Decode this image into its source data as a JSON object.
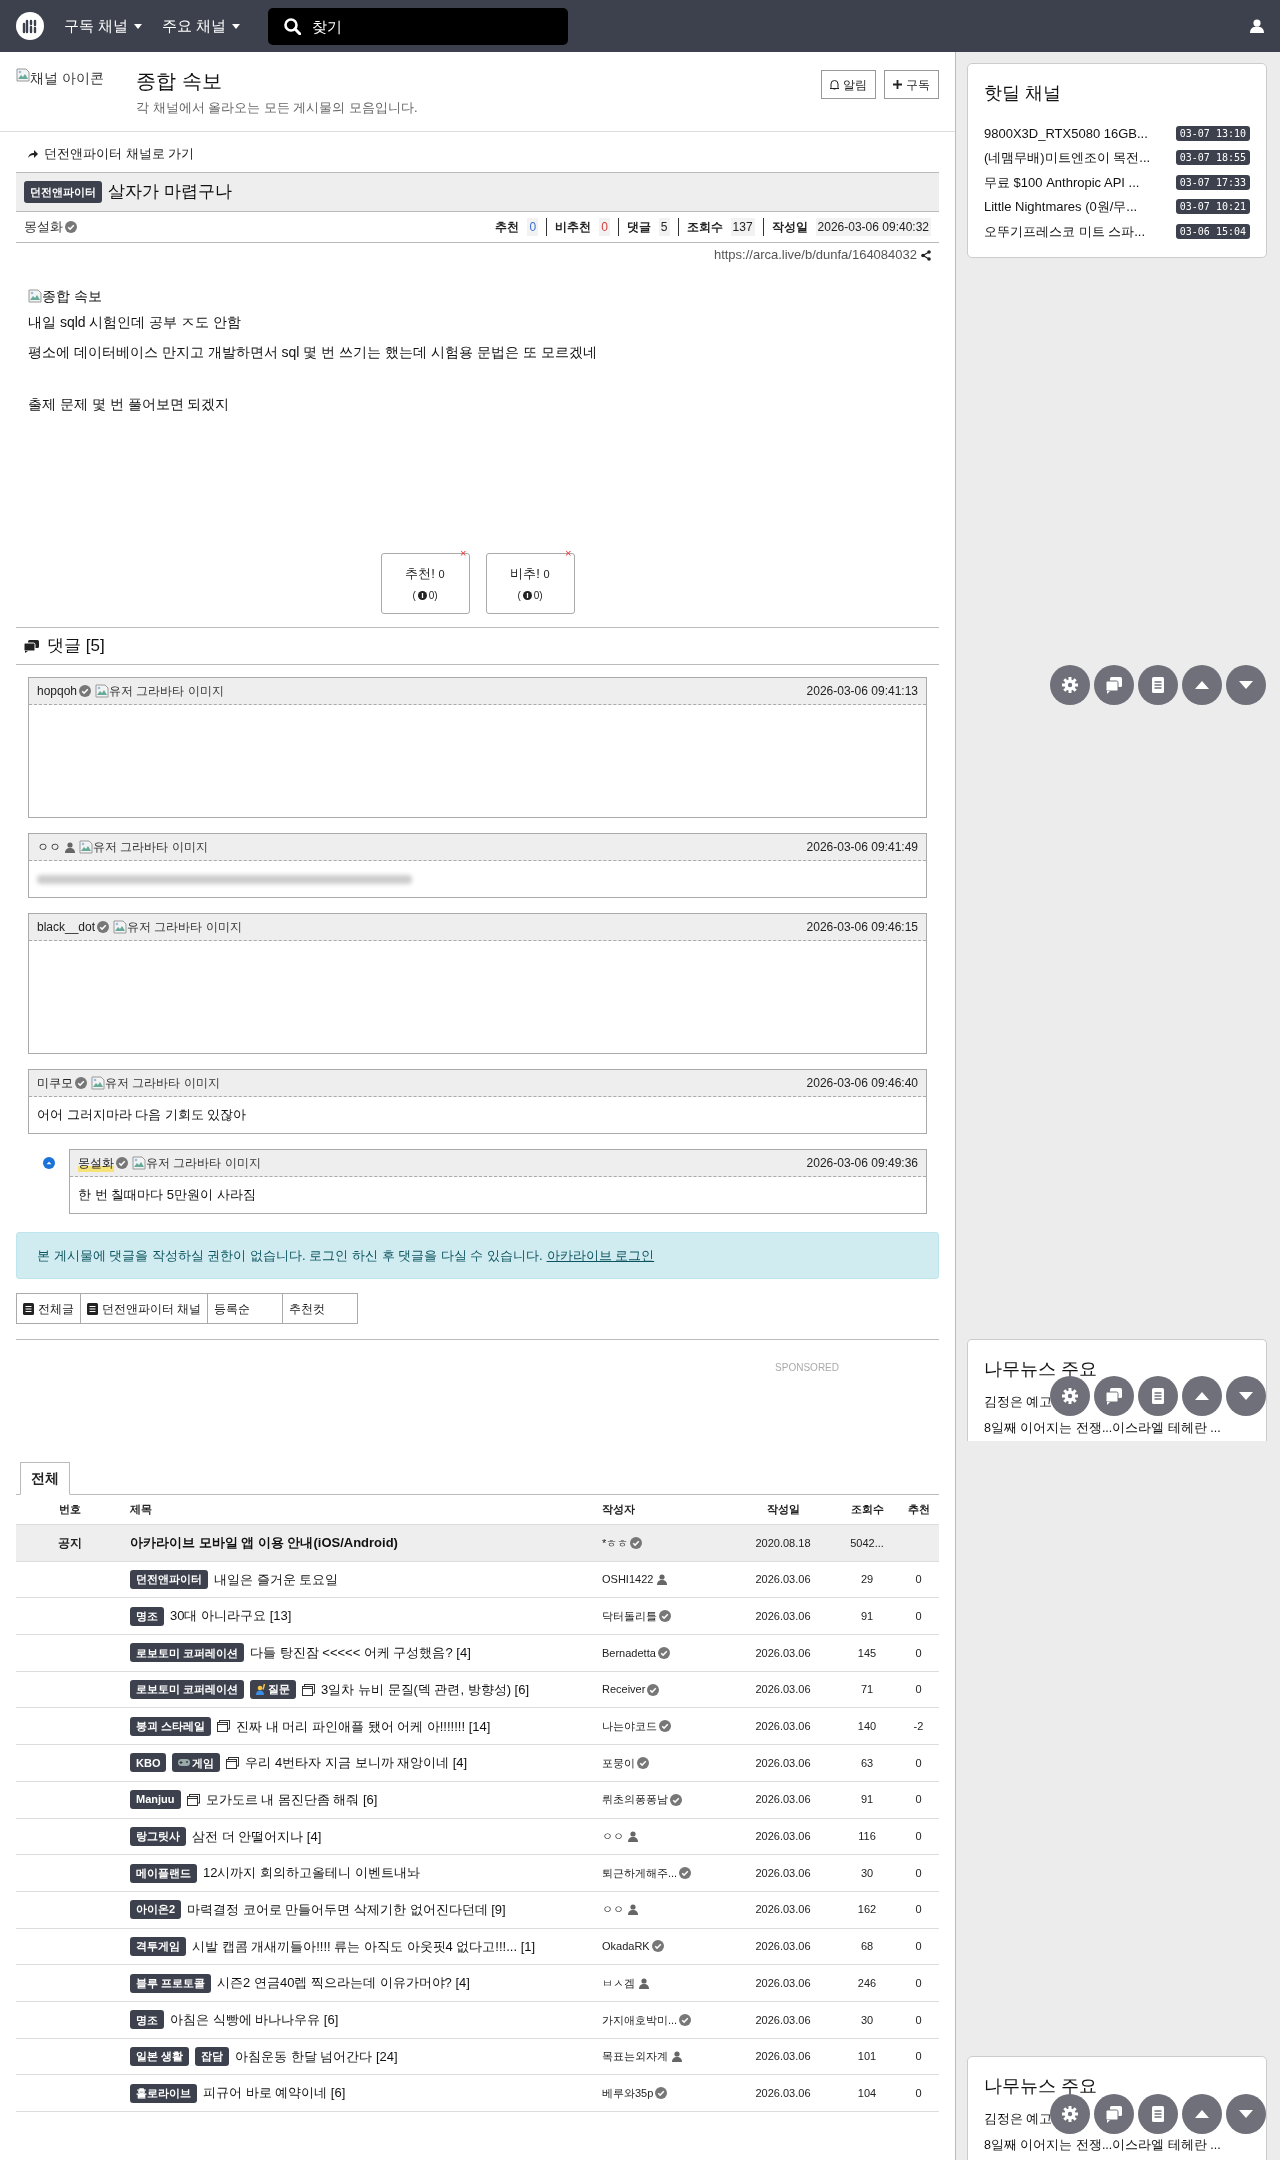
{
  "topbar": {
    "menus": [
      {
        "label": "구독 채널"
      },
      {
        "label": "주요 채널"
      }
    ],
    "search": {
      "placeholder": "찾기"
    }
  },
  "channel": {
    "icon_alt": "채널 아이콘",
    "title": "종합 속보",
    "description": "각 채널에서 올라오는 모든 게시물의 모음입니다.",
    "buttons": [
      {
        "kind": "bell",
        "label": "알림"
      },
      {
        "kind": "plus",
        "label": "구독"
      }
    ]
  },
  "post": {
    "back_link": "던전앤파이터 채널로 가기",
    "category": "던전앤파이터",
    "title": "살자가 마렵구나",
    "author": "몽설화",
    "verified": true,
    "stats": [
      {
        "label": "추천",
        "value": "0",
        "color": "#3b6fd8"
      },
      {
        "label": "비추천",
        "value": "0",
        "color": "#d33c3c"
      },
      {
        "label": "댓글",
        "value": "5"
      },
      {
        "label": "조회수",
        "value": "137"
      },
      {
        "label": "작성일",
        "value": "2026-03-06 09:40:32"
      }
    ],
    "url": "https://arca.live/b/dunfa/164084032",
    "image_alt": "종합 속보",
    "body": [
      "내일 sqld 시험인데 공부 ㅈ도 안함",
      "평소에 데이터베이스 만지고 개발하면서 sql 몇 번 쓰기는 했는데 시험용 문법은 또 모르겠네",
      "출제 문제 몇 번 풀어보면 되겠지"
    ],
    "votes": [
      {
        "label": "추천!",
        "count": "0",
        "sub_open": "(",
        "sub_count": "0)",
        "remove_mark": "×"
      },
      {
        "label": "비추!",
        "count": "0",
        "sub_open": "(",
        "sub_count": "0)",
        "remove_mark": "×"
      }
    ]
  },
  "comments": {
    "title": "댓글 [5]",
    "items": [
      {
        "kind": "blank",
        "author": "hopqoh",
        "verified": true,
        "avatar_alt": "유저 그라바타 이미지",
        "time": "2026-03-06 09:41:13",
        "reply": false,
        "is_op": false
      },
      {
        "kind": "blurred",
        "author": "ㅇㅇ",
        "verified": false,
        "avatar_alt": "유저 그라바타 이미지",
        "time": "2026-03-06 09:41:49",
        "reply": false,
        "is_op": false
      },
      {
        "kind": "blank",
        "author": "black__dot",
        "verified": true,
        "avatar_alt": "유저 그라바타 이미지",
        "time": "2026-03-06 09:46:15",
        "reply": false,
        "is_op": false
      },
      {
        "kind": "text",
        "author": "미쿠모",
        "verified": true,
        "avatar_alt": "유저 그라바타 이미지",
        "time": "2026-03-06 09:46:40",
        "body": "어어 그러지마라 다음 기회도 있잖아",
        "reply": false,
        "is_op": false
      },
      {
        "kind": "text",
        "author": "몽설화",
        "verified": true,
        "avatar_alt": "유저 그라바타 이미지",
        "time": "2026-03-06 09:49:36",
        "body": "한 번 칠때마다 5만원이 사라짐",
        "reply": true,
        "is_op": true
      }
    ]
  },
  "login_notice": {
    "text": "본 게시물에 댓글을 작성하실 권한이 없습니다. 로그인 하신 후 댓글을 다실 수 있습니다.",
    "link": "아카라이브 로그인"
  },
  "filters": [
    {
      "kind": "doc",
      "label": "전체글"
    },
    {
      "kind": "doc",
      "label": "던전앤파이터 채널"
    },
    {
      "kind": "plain",
      "label": "등록순"
    },
    {
      "kind": "plain",
      "label": "추천컷"
    }
  ],
  "sponsored": "SPONSORED",
  "board": {
    "tabs": [
      {
        "label": "전체",
        "selected": true
      }
    ],
    "columns": [
      "번호",
      "제목",
      "작성자",
      "작성일",
      "조회수",
      "추천"
    ],
    "rows": [
      {
        "kind": "notice",
        "number": "공지",
        "tags": [],
        "has_image": false,
        "title": "아카라이브 모바일 앱 이용 안내(iOS/Android)",
        "author": "*ㅎㅎ",
        "verified": true,
        "date": "2020.08.18",
        "views": "5042..."
      },
      {
        "kind": "post",
        "tags": [
          {
            "kind": "plain",
            "text": "던전앤파이터"
          }
        ],
        "has_image": false,
        "title": "내일은 즐거운 토요일",
        "author": "OSHI1422",
        "verified": false,
        "date": "2026.03.06",
        "views": "29",
        "votes": "0"
      },
      {
        "kind": "post",
        "tags": [
          {
            "kind": "plain",
            "text": "명조"
          }
        ],
        "has_image": false,
        "title": "30대 아니라구요 [13]",
        "author": "닥터돌리틀",
        "verified": true,
        "date": "2026.03.06",
        "views": "91",
        "votes": "0"
      },
      {
        "kind": "post",
        "tags": [
          {
            "kind": "plain",
            "text": "로보토미 코퍼레이션"
          }
        ],
        "has_image": false,
        "title": "다들 탕진잠 <<<<< 어케 구성했음? [4]",
        "author": "Bernadetta",
        "verified": true,
        "date": "2026.03.06",
        "views": "145",
        "votes": "0"
      },
      {
        "kind": "post",
        "tags": [
          {
            "kind": "plain",
            "text": "로보토미 코퍼레이션"
          },
          {
            "kind": "question",
            "text": "질문"
          }
        ],
        "has_image": true,
        "title": "3일차 뉴비 문질(덱 관련, 방향성) [6]",
        "author": "Receiver",
        "verified": true,
        "date": "2026.03.06",
        "views": "71",
        "votes": "0"
      },
      {
        "kind": "post",
        "tags": [
          {
            "kind": "plain",
            "text": "붕괴 스타레일"
          }
        ],
        "has_image": true,
        "title": "진짜 내 머리 파인애플 됐어 어케 아!!!!!!! [14]",
        "author": "나는야코드",
        "verified": true,
        "date": "2026.03.06",
        "views": "140",
        "votes": "-2"
      },
      {
        "kind": "post",
        "tags": [
          {
            "kind": "plain",
            "text": "KBO"
          },
          {
            "kind": "game",
            "text": "게임"
          }
        ],
        "has_image": true,
        "title": "우리 4번타자 지금 보니까 재앙이네 [4]",
        "author": "포뭉이",
        "verified": true,
        "date": "2026.03.06",
        "views": "63",
        "votes": "0"
      },
      {
        "kind": "post",
        "tags": [
          {
            "kind": "plain",
            "text": "Manjuu"
          }
        ],
        "has_image": true,
        "title": "모가도르 내 몸진단좀 해줘 [6]",
        "author": "뤼초의퐁퐁남",
        "verified": true,
        "date": "2026.03.06",
        "views": "91",
        "votes": "0"
      },
      {
        "kind": "post",
        "tags": [
          {
            "kind": "plain",
            "text": "랑그릿사"
          }
        ],
        "has_image": false,
        "title": "삼전 더 안떨어지나 [4]",
        "author": "ㅇㅇ",
        "verified": false,
        "date": "2026.03.06",
        "views": "116",
        "votes": "0"
      },
      {
        "kind": "post",
        "tags": [
          {
            "kind": "plain",
            "text": "메이플랜드"
          }
        ],
        "has_image": false,
        "title": "12시까지 회의하고올테니 이벤트내놔",
        "author": "퇴근하게해주...",
        "verified": true,
        "date": "2026.03.06",
        "views": "30",
        "votes": "0"
      },
      {
        "kind": "post",
        "tags": [
          {
            "kind": "plain",
            "text": "아이온2"
          }
        ],
        "has_image": false,
        "title": "마력결정 코어로 만들어두면 삭제기한 없어진다던데 [9]",
        "author": "ㅇㅇ",
        "verified": false,
        "date": "2026.03.06",
        "views": "162",
        "votes": "0"
      },
      {
        "kind": "post",
        "tags": [
          {
            "kind": "plain",
            "text": "격투게임"
          }
        ],
        "has_image": false,
        "title": "시발 캡콤 개새끼들아!!!! 류는 아직도 아웃핏4 없다고!!!... [1]",
        "author": "OkadaRK",
        "verified": true,
        "date": "2026.03.06",
        "views": "68",
        "votes": "0"
      },
      {
        "kind": "post",
        "tags": [
          {
            "kind": "plain",
            "text": "블루 프로토콜"
          }
        ],
        "has_image": false,
        "title": "시즌2 연금40렙 찍으라는데 이유가머야? [4]",
        "author": "ㅂㅅ겜",
        "verified": false,
        "date": "2026.03.06",
        "views": "246",
        "votes": "0"
      },
      {
        "kind": "post",
        "tags": [
          {
            "kind": "plain",
            "text": "명조"
          }
        ],
        "has_image": false,
        "title": "아침은 식빵에 바나나우유 [6]",
        "author": "가지애호박미...",
        "verified": true,
        "date": "2026.03.06",
        "views": "30",
        "votes": "0"
      },
      {
        "kind": "post",
        "tags": [
          {
            "kind": "plain",
            "text": "일본 생활"
          },
          {
            "kind": "plain",
            "text": "잡담"
          }
        ],
        "has_image": false,
        "title": "아침운동 한달 넘어간다 [24]",
        "author": "목표는외자계",
        "verified": false,
        "date": "2026.03.06",
        "views": "101",
        "votes": "0"
      },
      {
        "kind": "post",
        "tags": [
          {
            "kind": "plain",
            "text": "홀로라이브"
          }
        ],
        "has_image": false,
        "title": "피규어 바로 예약이네 [6]",
        "author": "베루와35p",
        "verified": true,
        "date": "2026.03.06",
        "views": "104",
        "votes": "0"
      }
    ]
  },
  "sidebar": {
    "hotdeal": {
      "title": "핫딜 채널",
      "items": [
        {
          "title": "9800X3D_RTX5080 16GB...",
          "time": "03-07 13:10"
        },
        {
          "title": "(네맴무배)미트엔조이 목전...",
          "time": "03-07 18:55"
        },
        {
          "title": "무료 $100 Anthropic API ...",
          "time": "03-07 17:33"
        },
        {
          "title": "Little Nightmares (0원/무...",
          "time": "03-07 10:21"
        },
        {
          "title": "오뚜기프레스코 미트 스파...",
          "time": "03-06 15:04"
        }
      ]
    },
    "news_cards": [
      {
        "title": "나무뉴스 주요",
        "lines": [
          "김정은 예고",
          "8일째 이어지는 전쟁...이스라엘 테헤란 ..."
        ]
      },
      {
        "title": "나무뉴스 주요",
        "lines": [
          "김정은 예고",
          "8일째 이어지는 전쟁...이스라엘 테헤란 ..."
        ]
      }
    ]
  }
}
